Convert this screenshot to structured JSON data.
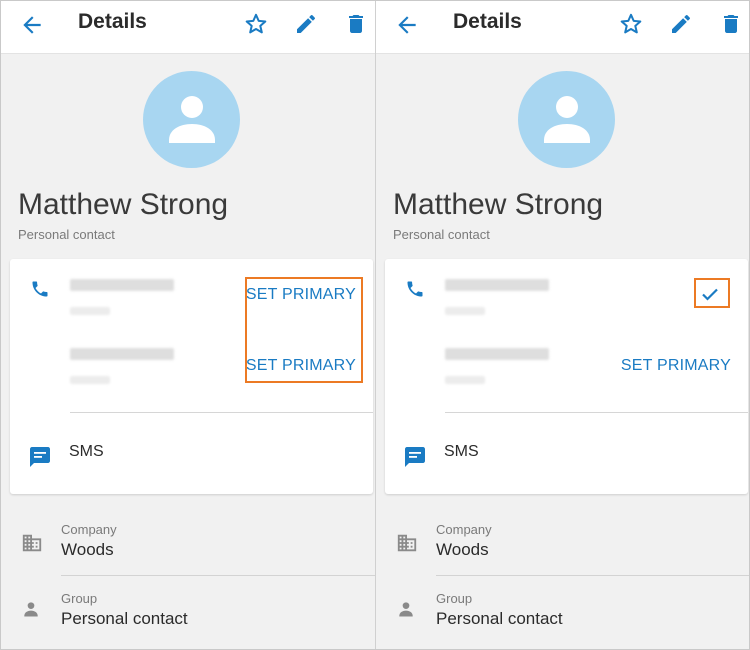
{
  "colors": {
    "accent": "#1a7bc3",
    "highlight": "#ec7a24",
    "avatar_bg": "#a8d6f1"
  },
  "panels": [
    {
      "appbar": {
        "title": "Details",
        "icons": [
          "arrow-back-icon",
          "star-icon",
          "pencil-icon",
          "trash-icon"
        ]
      },
      "contact": {
        "name": "Matthew Strong",
        "subtitle": "Personal contact"
      },
      "phones": [
        {
          "number": "(blurred)",
          "label": "(blurred)",
          "action": "SET PRIMARY",
          "primary": false
        },
        {
          "number": "(blurred)",
          "label": "(blurred)",
          "action": "SET PRIMARY",
          "primary": false
        }
      ],
      "sms_label": "SMS",
      "company": {
        "caption": "Company",
        "value": "Woods"
      },
      "group": {
        "caption": "Group",
        "value": "Personal contact"
      }
    },
    {
      "appbar": {
        "title": "Details",
        "icons": [
          "arrow-back-icon",
          "star-icon",
          "pencil-icon",
          "trash-icon"
        ]
      },
      "contact": {
        "name": "Matthew Strong",
        "subtitle": "Personal contact"
      },
      "phones": [
        {
          "number": "(blurred)",
          "label": "(blurred)",
          "action": "",
          "primary": true
        },
        {
          "number": "(blurred)",
          "label": "(blurred)",
          "action": "SET PRIMARY",
          "primary": false
        }
      ],
      "sms_label": "SMS",
      "company": {
        "caption": "Company",
        "value": "Woods"
      },
      "group": {
        "caption": "Group",
        "value": "Personal contact"
      }
    }
  ]
}
